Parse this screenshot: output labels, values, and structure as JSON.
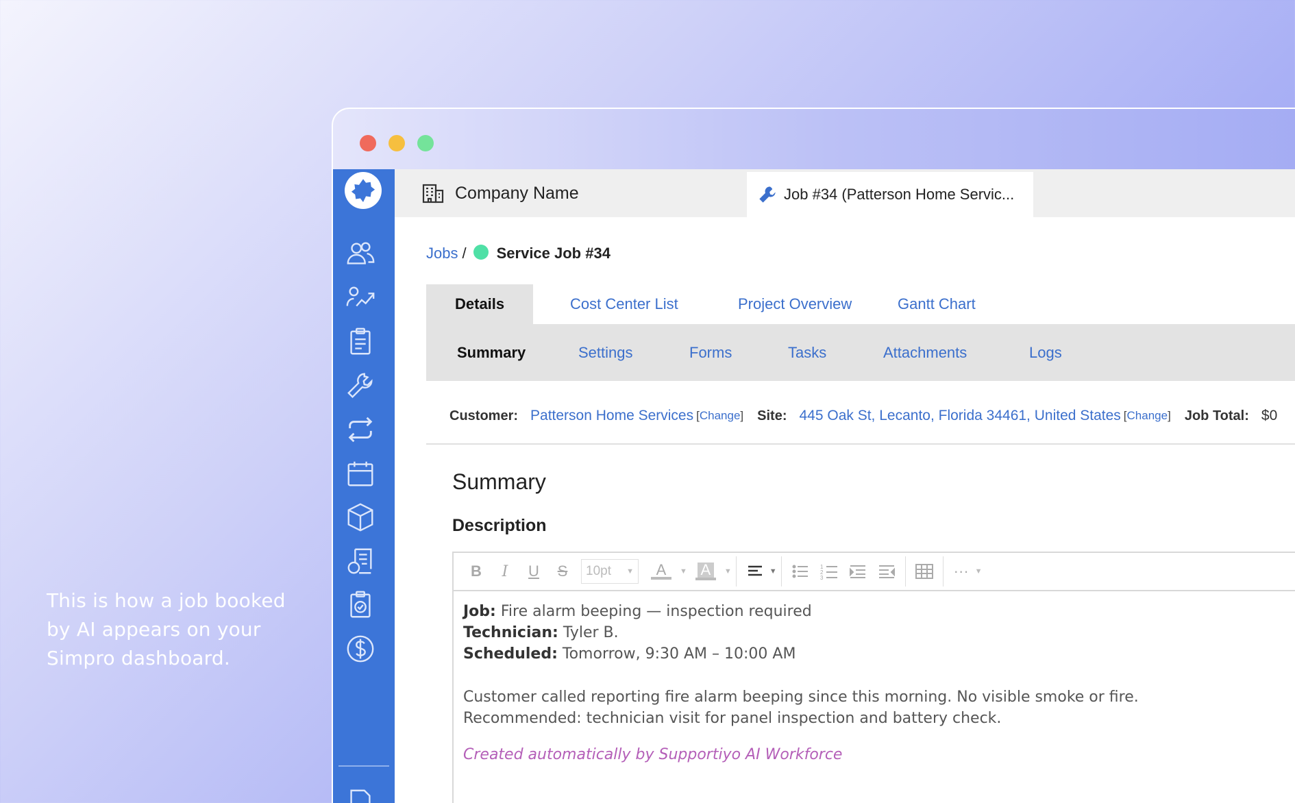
{
  "caption": "This is how a job booked by AI appears on your Simpro dashboard.",
  "app_tabs": {
    "company": "Company Name",
    "job": "Job #34 (Patterson Home Servic..."
  },
  "breadcrumb": {
    "root": "Jobs",
    "separator": "/",
    "title": "Service Job #34"
  },
  "primary_tabs": [
    "Details",
    "Cost Center List",
    "Project Overview",
    "Gantt Chart"
  ],
  "secondary_tabs": [
    "Summary",
    "Settings",
    "Forms",
    "Tasks",
    "Attachments",
    "Logs"
  ],
  "info": {
    "customer_label": "Customer:",
    "customer_value": "Patterson Home Services",
    "site_label": "Site:",
    "site_value": "445 Oak St, Lecanto, Florida 34461, United States",
    "change_label": "Change",
    "job_total_label": "Job Total:",
    "job_total_value": "$0"
  },
  "summary_heading": "Summary",
  "description_heading": "Description",
  "editor": {
    "font_size": "10pt",
    "job_label": "Job:",
    "job_value": "Fire alarm beeping — inspection required",
    "technician_label": "Technician:",
    "technician_value": "Tyler B.",
    "scheduled_label": "Scheduled:",
    "scheduled_value": "Tomorrow, 9:30 AM – 10:00 AM",
    "body_line1": "Customer called reporting fire alarm beeping since this morning. No visible smoke or fire.",
    "body_line2": "Recommended: technician visit for panel inspection and battery check.",
    "signature": "Created automatically by Supportiyo AI Workforce"
  },
  "colors": {
    "sidebar": "#3c75d8",
    "link": "#3b6fcc",
    "status_dot": "#4fe0a6",
    "signature": "#b45fb8"
  },
  "icons": {
    "sidebar": [
      "people-icon",
      "growth-icon",
      "clipboard-icon",
      "wrench-icon",
      "recurring-icon",
      "calendar-icon",
      "box-icon",
      "invoice-icon",
      "checklist-icon",
      "dollar-icon",
      "document-icon"
    ]
  }
}
